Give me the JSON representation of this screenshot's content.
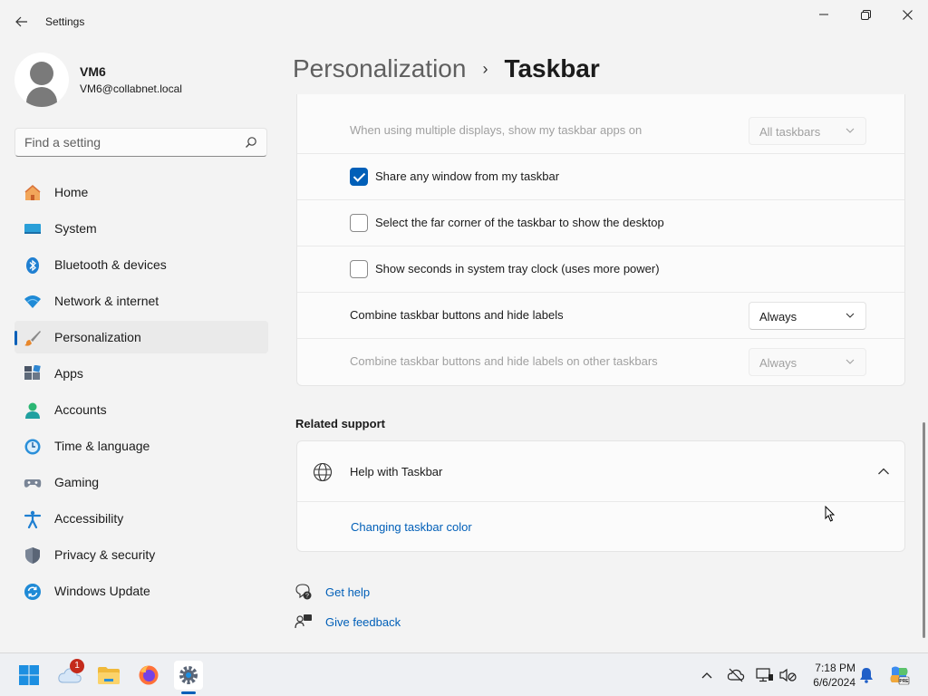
{
  "window": {
    "title": "Settings"
  },
  "user": {
    "name": "VM6",
    "email": "VM6@collabnet.local"
  },
  "search": {
    "placeholder": "Find a setting"
  },
  "nav": {
    "items": [
      {
        "label": "Home",
        "icon": "home-icon"
      },
      {
        "label": "System",
        "icon": "system-icon"
      },
      {
        "label": "Bluetooth & devices",
        "icon": "bluetooth-icon"
      },
      {
        "label": "Network & internet",
        "icon": "network-icon"
      },
      {
        "label": "Personalization",
        "icon": "personalization-icon",
        "active": true
      },
      {
        "label": "Apps",
        "icon": "apps-icon"
      },
      {
        "label": "Accounts",
        "icon": "accounts-icon"
      },
      {
        "label": "Time & language",
        "icon": "time-language-icon"
      },
      {
        "label": "Gaming",
        "icon": "gaming-icon"
      },
      {
        "label": "Accessibility",
        "icon": "accessibility-icon"
      },
      {
        "label": "Privacy & security",
        "icon": "privacy-icon"
      },
      {
        "label": "Windows Update",
        "icon": "windows-update-icon"
      }
    ]
  },
  "breadcrumb": {
    "parent": "Personalization",
    "current": "Taskbar"
  },
  "settings": {
    "multi_display": {
      "label": "When using multiple displays, show my taskbar apps on",
      "value": "All taskbars",
      "disabled": true
    },
    "share_window": {
      "label": "Share any window from my taskbar",
      "checked": true
    },
    "far_corner": {
      "label": "Select the far corner of the taskbar to show the desktop",
      "checked": false
    },
    "show_seconds": {
      "label": "Show seconds in system tray clock (uses more power)",
      "checked": false
    },
    "combine": {
      "label": "Combine taskbar buttons and hide labels",
      "value": "Always"
    },
    "combine_other": {
      "label": "Combine taskbar buttons and hide labels on other taskbars",
      "value": "Always",
      "disabled": true
    }
  },
  "related_support": {
    "heading": "Related support",
    "help_title": "Help with Taskbar",
    "link": "Changing taskbar color"
  },
  "footer": {
    "get_help": "Get help",
    "give_feedback": "Give feedback"
  },
  "taskbar": {
    "weather_badge": "1",
    "time": "7:18 PM",
    "date": "6/6/2024"
  },
  "colors": {
    "accent": "#005fb8",
    "background": "#f3f3f3",
    "card": "#fbfbfb",
    "badge": "#c42b1c"
  }
}
